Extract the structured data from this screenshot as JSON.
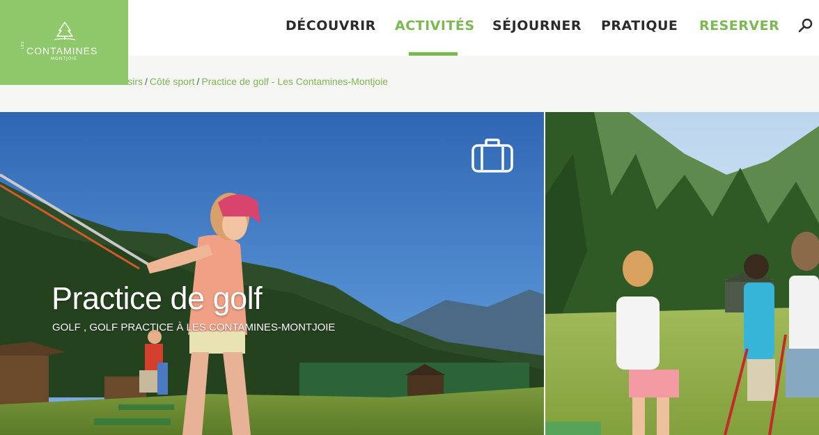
{
  "logo": {
    "prefix": "LES",
    "name": "CONTAMINES",
    "sub": "MONTJOIE"
  },
  "nav": {
    "items": [
      {
        "label": "DÉCOUVRIR"
      },
      {
        "label": "ACTIVITÉS"
      },
      {
        "label": "SÉJOURNER"
      },
      {
        "label": "PRATIQUE"
      },
      {
        "label": "RESERVER"
      }
    ],
    "active_index": 1,
    "colors": {
      "default": "#2b2b2b",
      "accent": "#7ab851"
    }
  },
  "breadcrumb": {
    "items": [
      "t de loisirs",
      "Côté sport",
      "Practice de golf - Les Contamines-Montjoie"
    ],
    "separator": "/"
  },
  "hero": {
    "title": "Practice de golf",
    "subtitle": "GOLF ,  GOLF PRACTICE À LES CONTAMINES-MONTJOIE"
  },
  "colors": {
    "brand_green": "#8fc86a",
    "accent_green": "#7ab851",
    "breadcrumb_bg": "#f5f5f4"
  },
  "icons": [
    "tree-logo-icon",
    "search-icon",
    "briefcase-icon"
  ]
}
